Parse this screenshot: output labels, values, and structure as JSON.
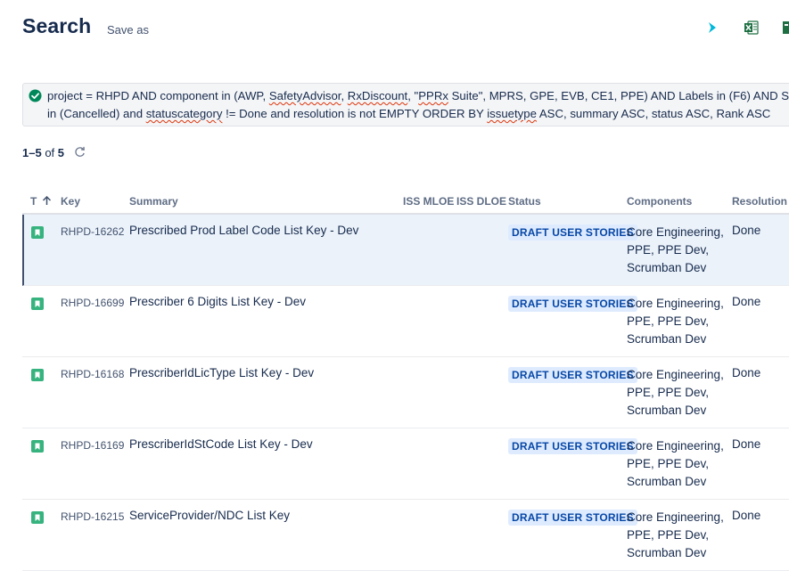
{
  "header": {
    "title": "Search",
    "save_as": "Save as"
  },
  "jql": {
    "line1_parts": [
      "project = RHPD AND component in (AWP, ",
      "SafetyAdvisor",
      ", ",
      "RxDiscount",
      ", \"",
      "PPRx",
      " Suite\", MPRS, GPE, EVB, CE1, PPE) AND Labels in (F6) AND S"
    ],
    "line2_parts": [
      "in (Cancelled) and ",
      "statuscategory",
      " != Done and resolution is not EMPTY ORDER BY ",
      "issuetype",
      " ASC, summary ASC, status ASC, Rank ASC"
    ]
  },
  "results": {
    "range": "1–5",
    "of": "of",
    "total": "5"
  },
  "columns": {
    "type": "T",
    "key": "Key",
    "summary": "Summary",
    "iss_mloe": "ISS MLOE",
    "iss_dloe": "ISS DLOE",
    "status": "Status",
    "components": "Components",
    "resolution": "Resolution"
  },
  "issues": [
    {
      "key": "RHPD-16262",
      "summary": "Prescribed Prod Label Code List Key - Dev",
      "status": "DRAFT USER STORIES",
      "components": "Core Engineering, PPE, PPE Dev, Scrumban Dev",
      "resolution": "Done"
    },
    {
      "key": "RHPD-16699",
      "summary": "Prescriber 6 Digits List Key - Dev",
      "status": "DRAFT USER STORIES",
      "components": "Core Engineering, PPE, PPE Dev, Scrumban Dev",
      "resolution": "Done"
    },
    {
      "key": "RHPD-16168",
      "summary": "PrescriberIdLicType List Key - Dev",
      "status": "DRAFT USER STORIES",
      "components": "Core Engineering, PPE, PPE Dev, Scrumban Dev",
      "resolution": "Done"
    },
    {
      "key": "RHPD-16169",
      "summary": "PrescriberIdStCode List Key - Dev",
      "status": "DRAFT USER STORIES",
      "components": "Core Engineering, PPE, PPE Dev, Scrumban Dev",
      "resolution": "Done"
    },
    {
      "key": "RHPD-16215",
      "summary": "ServiceProvider/NDC List Key",
      "status": "DRAFT USER STORIES",
      "components": "Core Engineering, PPE, PPE Dev, Scrumban Dev",
      "resolution": "Done"
    }
  ],
  "colors": {
    "story_icon": "#36b37e",
    "status_bg": "#deebff",
    "status_text": "#0747a6",
    "selected_row": "#ebf2fa",
    "check": "#00875a"
  },
  "icons": {
    "share": "share-icon",
    "excel": "excel-icon",
    "check": "check-circle-icon",
    "refresh": "refresh-icon",
    "sort": "sort-up-arrow-icon",
    "type": "story-icon"
  }
}
